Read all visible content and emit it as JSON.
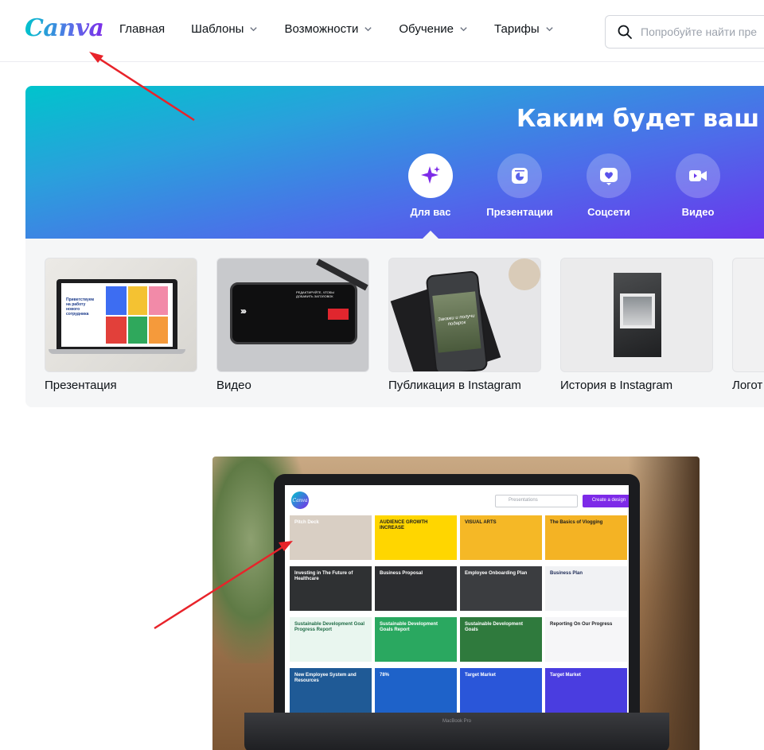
{
  "header": {
    "logo": "Canva",
    "nav": [
      {
        "label": "Главная",
        "has_dropdown": false
      },
      {
        "label": "Шаблоны",
        "has_dropdown": true
      },
      {
        "label": "Возможности",
        "has_dropdown": true
      },
      {
        "label": "Обучение",
        "has_dropdown": true
      },
      {
        "label": "Тарифы",
        "has_dropdown": true
      }
    ],
    "search": {
      "placeholder": "Попробуйте найти пре",
      "icon": "search-icon"
    }
  },
  "hero": {
    "title": "Каким будет ваш д",
    "categories": [
      {
        "label": "Для вас",
        "icon": "sparkle-icon",
        "active": true
      },
      {
        "label": "Презентации",
        "icon": "presentation-icon",
        "active": false
      },
      {
        "label": "Соцсети",
        "icon": "heart-icon",
        "active": false
      },
      {
        "label": "Видео",
        "icon": "video-camera-icon",
        "active": false
      }
    ]
  },
  "design_types": [
    {
      "label": "Презентация"
    },
    {
      "label": "Видео"
    },
    {
      "label": "Публикация в Instagram"
    },
    {
      "label": "История в Instagram"
    },
    {
      "label": "Логот"
    }
  ],
  "thumbs": {
    "presentation_text": "Приветствуем на работу нового сотрудника",
    "video_text": "РЕДАКТИРУЙТЕ, ЧТОБЫ ДОБАВИТЬ ЗАГОЛОВОК",
    "instagram_text": "Закажи и получи подарок"
  },
  "laptop_screen": {
    "logo": "Canva",
    "search_placeholder": "Presentations",
    "create_button": "Create a design",
    "brand": "MacBook Pro",
    "tiles": [
      {
        "text": "Pitch Deck",
        "bg": "#d9cfc4",
        "color": "#ffffff"
      },
      {
        "text": "AUDIENCE GROWTH INCREASE",
        "bg": "#ffd600",
        "color": "#1b1c1f"
      },
      {
        "text": "VISUAL ARTS",
        "bg": "#f5b826",
        "color": "#1b1c1f"
      },
      {
        "text": "The Basics of Vlogging",
        "bg": "#f4b324",
        "color": "#1b1c1f"
      },
      {
        "text": "Investing in The Future of Healthcare",
        "bg": "#2f3133",
        "color": "#ffffff"
      },
      {
        "text": "Business Proposal",
        "bg": "#2c2d30",
        "color": "#ffffff"
      },
      {
        "text": "Employee Onboarding Plan",
        "bg": "#3b3d40",
        "color": "#ffffff"
      },
      {
        "text": "Business Plan",
        "bg": "#f1f2f4",
        "color": "#1c2a55"
      },
      {
        "text": "Sustainable Development Goal Progress Report",
        "bg": "#e9f6ef",
        "color": "#1f6b45"
      },
      {
        "text": "Sustainable Development Goals Report",
        "bg": "#2aa860",
        "color": "#ffffff"
      },
      {
        "text": "Sustainable Development Goals",
        "bg": "#2f7a3d",
        "color": "#ffffff"
      },
      {
        "text": "Reporting On Our Progress",
        "bg": "#f6f6f8",
        "color": "#1b1c1f"
      },
      {
        "text": "New Employee System and Resources",
        "bg": "#1f5a96",
        "color": "#ffffff"
      },
      {
        "text": "78%",
        "bg": "#1e62c9",
        "color": "#ffffff"
      },
      {
        "text": "Target Market",
        "bg": "#2a56d9",
        "color": "#ffffff"
      },
      {
        "text": "Target Market",
        "bg": "#4a3de0",
        "color": "#ffffff"
      }
    ]
  },
  "colors": {
    "brand_teal": "#00c4cc",
    "brand_purple": "#7d2ae8",
    "annotation_arrow": "#e8232a",
    "strip_bg": "#f5f6f7"
  }
}
